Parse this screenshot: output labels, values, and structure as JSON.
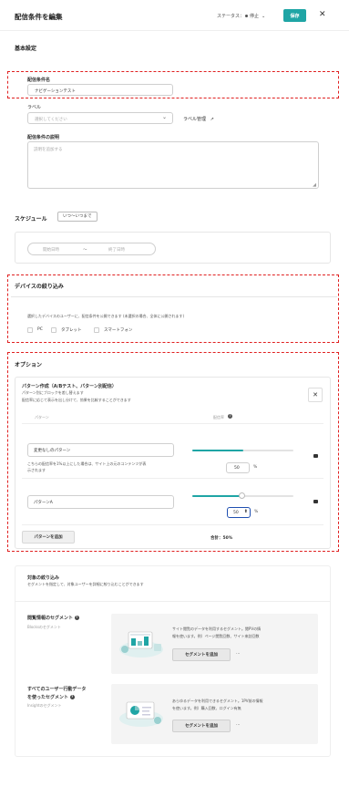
{
  "header": {
    "title": "配信条件を編集",
    "status_label": "ステータス：",
    "status_value": "停止",
    "save_label": "保存"
  },
  "basic": {
    "section_title": "基本設定",
    "name_label": "配信条件名",
    "name_value": "ナビゲーションテスト",
    "label_label": "ラベル",
    "label_placeholder": "選択してください",
    "label_manage": "ラベル管理",
    "desc_label": "配信条件の説明",
    "desc_placeholder": "説明を追加する"
  },
  "schedule": {
    "title": "スケジュール",
    "badge": "いつ〜いつまで",
    "start_placeholder": "開始日時",
    "separator": "〜",
    "end_placeholder": "終了日時"
  },
  "device": {
    "title": "デバイスの絞り込み",
    "note": "選択したデバイスのユーザーに、配信条件を公開できます (未選択の場合、全体に公開されます)",
    "options": [
      "PC",
      "タブレット",
      "スマートフォン"
    ]
  },
  "options": {
    "title": "オプション",
    "pattern_title": "パターン作成（A/Bテスト、パターン別配信）",
    "pattern_desc1": "パターン別にブロックを差し替えます",
    "pattern_desc2": "配信率に応じて表示を出し分けて、効果を比較することができます",
    "col_pattern": "パターン",
    "col_rate": "配信率",
    "row1_name": "変更なしのパターン",
    "row1_note1": "こちらの配信率を1%以上にした場合は、サイト上の元のコンテンツが表",
    "row1_note2": "示されます",
    "row1_rate": "50",
    "row1_fraction": 0.5,
    "row2_name": "パターンA",
    "row2_rate": "50",
    "row2_fraction": 0.5,
    "percent": "%",
    "add_pattern": "パターンを追加",
    "total": "合計：50%"
  },
  "target": {
    "title": "対象の絞り込み",
    "desc": "セグメントを指定して、対象ユーザーを詳細に絞り込むことができます",
    "seg1_title": "閲覧情報のセグメント",
    "seg1_sub": "Blocksのセグメント",
    "seg1_text1": "サイト閲覧のデータを利用するセグメント。閲PVの情",
    "seg1_text2": "報を使います。例）ページ閲覧回数、サイト来訪回数",
    "seg1_button": "セグメントを追加",
    "seg2_title1": "すべてのユーザー行動データ",
    "seg2_title2": "を使ったセグメント",
    "seg2_sub": "Insightのセグメント",
    "seg2_text1": "あらゆるデータを利用できるセグメント。1PV前の情報",
    "seg2_text2": "を使います。例）購入回数、ログイン有無",
    "seg2_button": "セグメントを追加",
    "more": "…"
  },
  "colors": {
    "accent": "#1fa5a5",
    "highlight": "#e02020"
  }
}
